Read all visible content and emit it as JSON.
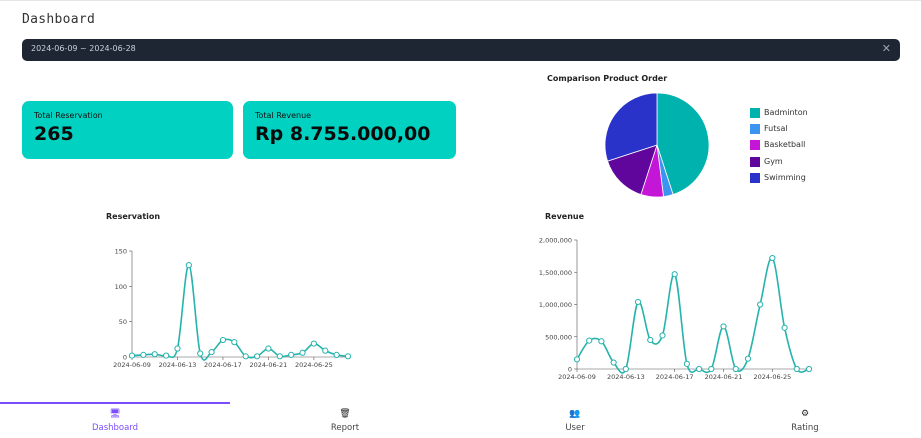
{
  "header": {
    "title": "Dashboard"
  },
  "date_filter": {
    "value": "2024-06-09 ~ 2024-06-28",
    "clear_icon": "close-icon"
  },
  "stats": {
    "total_reservation": {
      "label": "Total Reservation",
      "value": "265"
    },
    "total_revenue": {
      "label": "Total Revenue",
      "value": "Rp 8.755.000,00"
    }
  },
  "colors": {
    "accent": "#00d1c1",
    "line": "#26b3ad",
    "nav_active": "#7c4dff",
    "date_bar": "#1e2633"
  },
  "chart_data": [
    {
      "type": "pie",
      "title": "Comparison Product Order",
      "legend_position": "right",
      "categories": [
        "Badminton",
        "Futsal",
        "Basketball",
        "Gym",
        "Swimming"
      ],
      "values": [
        45,
        3,
        7,
        15,
        30
      ],
      "colors": [
        "#00b2ad",
        "#3a94f0",
        "#c316d6",
        "#60069c",
        "#2932c9"
      ]
    },
    {
      "type": "line",
      "title": "Reservation",
      "x_tick_labels": [
        "2024-06-09",
        "2024-06-13",
        "2024-06-17",
        "2024-06-21",
        "2024-06-25"
      ],
      "x_ticks_index": [
        0,
        4,
        8,
        12,
        16
      ],
      "y_ticks": [
        0,
        50,
        100,
        150
      ],
      "ylim": [
        0,
        150
      ],
      "values": [
        2,
        3,
        4,
        2,
        12,
        130,
        5,
        7,
        24,
        21,
        1,
        1,
        12,
        1,
        3,
        6,
        19,
        9,
        3,
        1
      ]
    },
    {
      "type": "line",
      "title": "Revenue",
      "x_tick_labels": [
        "2024-06-09",
        "2024-06-13",
        "2024-06-17",
        "2024-06-21",
        "2024-06-25"
      ],
      "x_ticks_index": [
        0,
        4,
        8,
        12,
        16
      ],
      "y_ticks": [
        0,
        500000,
        1000000,
        1500000,
        2000000
      ],
      "y_tick_labels": [
        "0",
        "500,000",
        "1,000,000",
        "1,500,000",
        "2,000,000"
      ],
      "ylim": [
        0,
        2000000
      ],
      "values": [
        150000,
        440000,
        430000,
        100000,
        0,
        1040000,
        450000,
        520000,
        1470000,
        80000,
        0,
        0,
        660000,
        0,
        160000,
        1000000,
        1720000,
        640000,
        0,
        0
      ]
    }
  ],
  "nav": {
    "items": [
      {
        "label": "Dashboard",
        "icon": "monitor-icon"
      },
      {
        "label": "Report",
        "icon": "trash-icon"
      },
      {
        "label": "User",
        "icon": "users-icon"
      },
      {
        "label": "Rating",
        "icon": "network-icon"
      }
    ]
  }
}
